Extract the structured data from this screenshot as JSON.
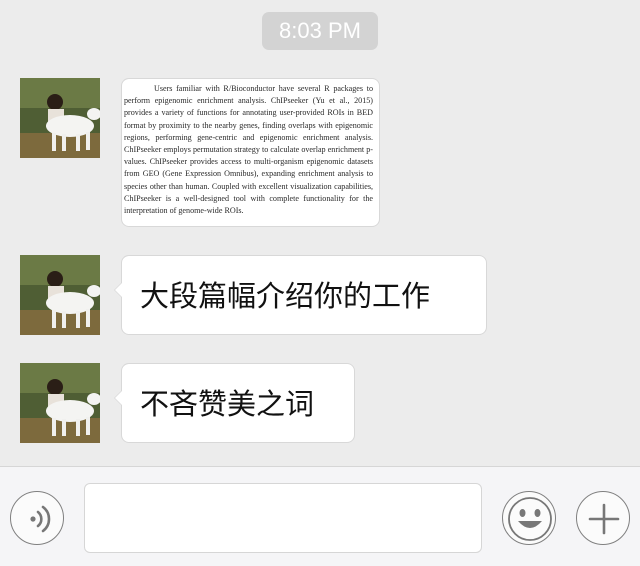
{
  "timestamp": "8:03 PM",
  "messages": [
    {
      "type": "image",
      "abstract": "Users familiar with R/Bioconductor have several R packages to perform epigenomic enrichment analysis. ChIPseeker (Yu et al., 2015) provides a variety of functions for annotating user-provided ROIs in BED format by proximity to the nearby genes, finding overlaps with epigenomic regions, performing gene-centric and epigenomic enrichment analysis. ChIPseeker employs permutation strategy to calculate overlap enrichment p-values. ChIPseeker provides access to multi-organism epigenomic datasets from GEO (Gene Expression Omnibus), expanding enrichment analysis to species other than human. Coupled with excellent visualization capabilities, ChIPseeker is a well-designed tool with complete functionality for the interpretation of genome-wide ROIs."
    },
    {
      "type": "text",
      "text": "大段篇幅介绍你的工作"
    },
    {
      "type": "text",
      "text": "不吝赞美之词"
    }
  ],
  "input_bar": {
    "voice_icon": "voice-icon",
    "emoji_icon": "emoji-icon",
    "plus_icon": "plus-icon",
    "message_value": ""
  }
}
